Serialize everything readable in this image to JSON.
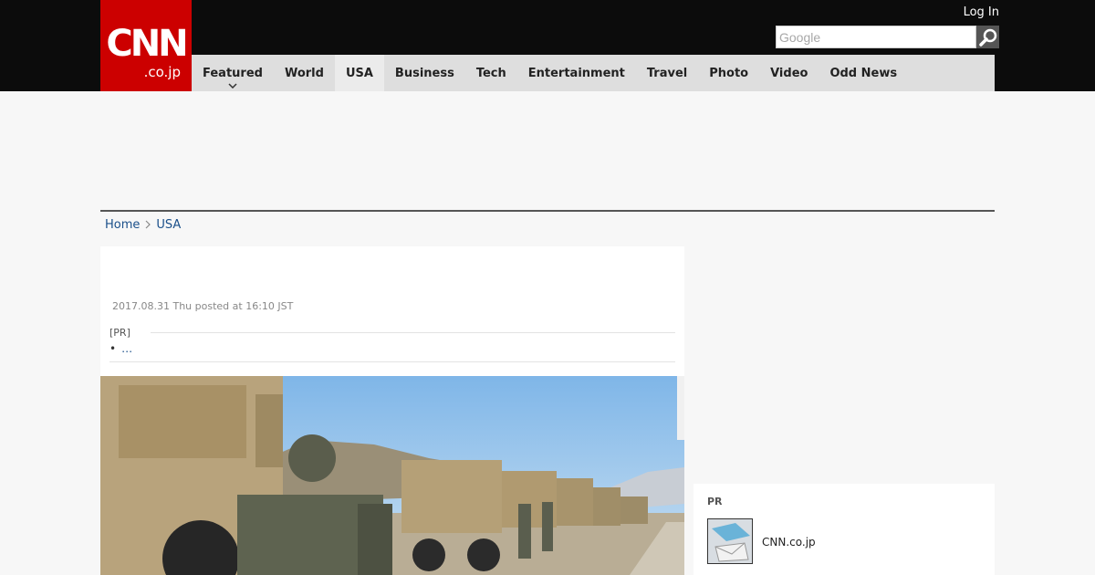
{
  "header": {
    "logo_main": "CNN",
    "logo_sub": ".co.jp",
    "login": "Log In",
    "search_placeholder": "Google"
  },
  "nav": {
    "items": [
      "Featured",
      "World",
      "USA",
      "Business",
      "Tech",
      "Entertainment",
      "Travel",
      "Photo",
      "Video",
      "Odd News"
    ],
    "active": "USA"
  },
  "breadcrumb": {
    "home": "Home",
    "section": "USA"
  },
  "article": {
    "date": "2017.08.31 Thu posted at 16:10 JST",
    "pr_label": "[PR]",
    "pr_link": "…"
  },
  "sidebar": {
    "pr_label": "PR",
    "pr_item": "CNN.co.jp"
  },
  "colors": {
    "brand": "#cc0000",
    "link": "#1a4f8a",
    "topbar": "#0c0c0c",
    "nav": "#dedede"
  }
}
